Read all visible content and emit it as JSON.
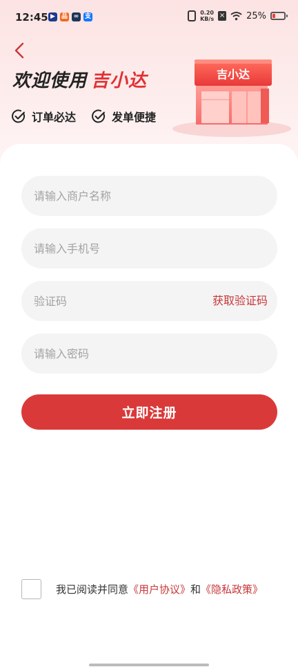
{
  "status_bar": {
    "time": "12:45",
    "app_icons": [
      {
        "name": "app-icon-play",
        "glyph": "▶",
        "color": "#1f3a8a"
      },
      {
        "name": "app-icon-orange",
        "glyph": "品",
        "color": "#ef6a1f"
      },
      {
        "name": "app-icon-link",
        "glyph": "∞",
        "color": "#1d3557"
      },
      {
        "name": "app-icon-alipay",
        "glyph": "支",
        "color": "#1677ff"
      }
    ],
    "speed_value": "0.20",
    "speed_unit": "KB/s",
    "battery_text": "25%",
    "battery_level": 0.25
  },
  "header": {
    "welcome_prefix": "欢迎使用",
    "brand": "吉小达",
    "features": [
      "订单必达",
      "发单便捷"
    ],
    "store_sign": "吉小达"
  },
  "form": {
    "merchant_name_placeholder": "请输入商户名称",
    "phone_placeholder": "请输入手机号",
    "code_placeholder": "验证码",
    "get_code_label": "获取验证码",
    "password_placeholder": "请输入密码",
    "submit_label": "立即注册"
  },
  "agreement": {
    "prefix": "我已阅读并同意",
    "user_agreement": "《用户协议》",
    "conjunction": "和",
    "privacy_policy": "《隐私政策》"
  },
  "colors": {
    "accent": "#d93a39",
    "link": "#c6373a",
    "hero_bg": "#fde3e3"
  }
}
